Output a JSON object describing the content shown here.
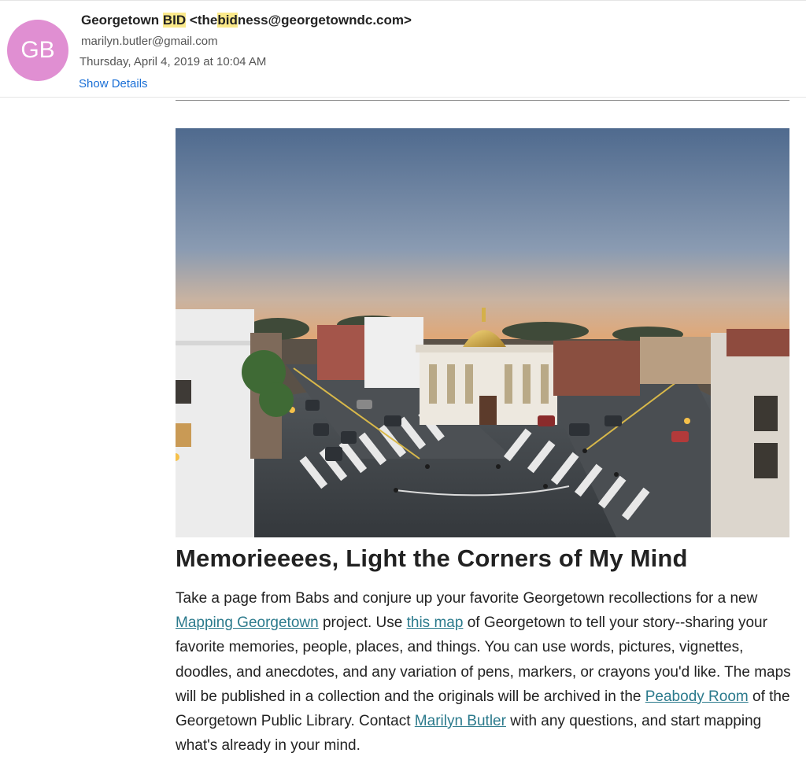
{
  "header": {
    "avatar_initials": "GB",
    "sender": {
      "name_before": "Georgetown ",
      "name_highlight": "BID",
      "email_before": " <the",
      "email_highlight": "bid",
      "email_after": "ness@georgetowndc.com>"
    },
    "recipient": "marilyn.butler@gmail.com",
    "date": "Thursday, April 4, 2019 at 10:04 AM",
    "show_details_label": "Show Details"
  },
  "article": {
    "title": "Memorieeees, Light the Corners of My Mind",
    "body": {
      "t1": "Take a page from Babs and conjure up your favorite Georgetown recollections for a new ",
      "link_mapping": "Mapping Georgetown",
      "t2": " project. Use ",
      "link_map": "this map",
      "t3": " of Georgetown to tell your story--sharing your favorite memories, people, places, and things. You can use words, pictures, vignettes, doodles, and anecdotes, and any variation of pens, markers, or crayons you'd like. The maps will be published in a collection and the originals will be archived in the ",
      "link_peabody": "Peabody Room",
      "t4": " of the Georgetown Public Library. Contact ",
      "link_contact": "Marilyn Butler",
      "t5": " with any questions, and start mapping what's already in your mind."
    }
  },
  "colors": {
    "avatar": "#e08fd2",
    "highlight": "#fbe98a",
    "show_details_link": "#1a6fd6",
    "body_link": "#2b7a8c"
  }
}
